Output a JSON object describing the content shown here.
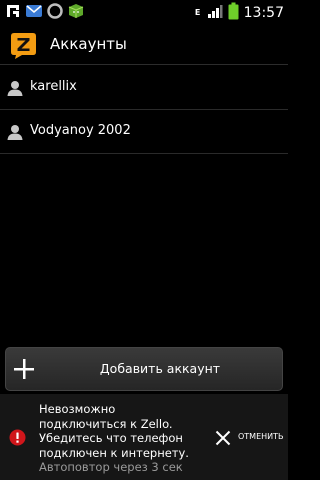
{
  "status_bar": {
    "time": "13:57",
    "network_type": "E",
    "notification_icons": [
      "app-notification-icon",
      "email-icon",
      "circle-icon",
      "android-market-icon"
    ],
    "system_icons": [
      "signal-icon",
      "battery-icon"
    ]
  },
  "header": {
    "title": "Аккаунты",
    "logo_letter": "Z"
  },
  "accounts": [
    {
      "name": "karellix"
    },
    {
      "name": "Vodyanoy 2002"
    }
  ],
  "add_button": {
    "label": "Добавить аккаунт"
  },
  "error_banner": {
    "message": "Невозможно подключиться к Zello. Убедитесь что телефон подключен к интернету.",
    "retry": "Автоповтор через 3 сек",
    "cancel_label": "ОТМЕНИТЬ"
  },
  "colors": {
    "background": "#000000",
    "logo_orange": "#f39c12",
    "error_red": "#d0161b",
    "battery_green": "#6fcf2a"
  }
}
